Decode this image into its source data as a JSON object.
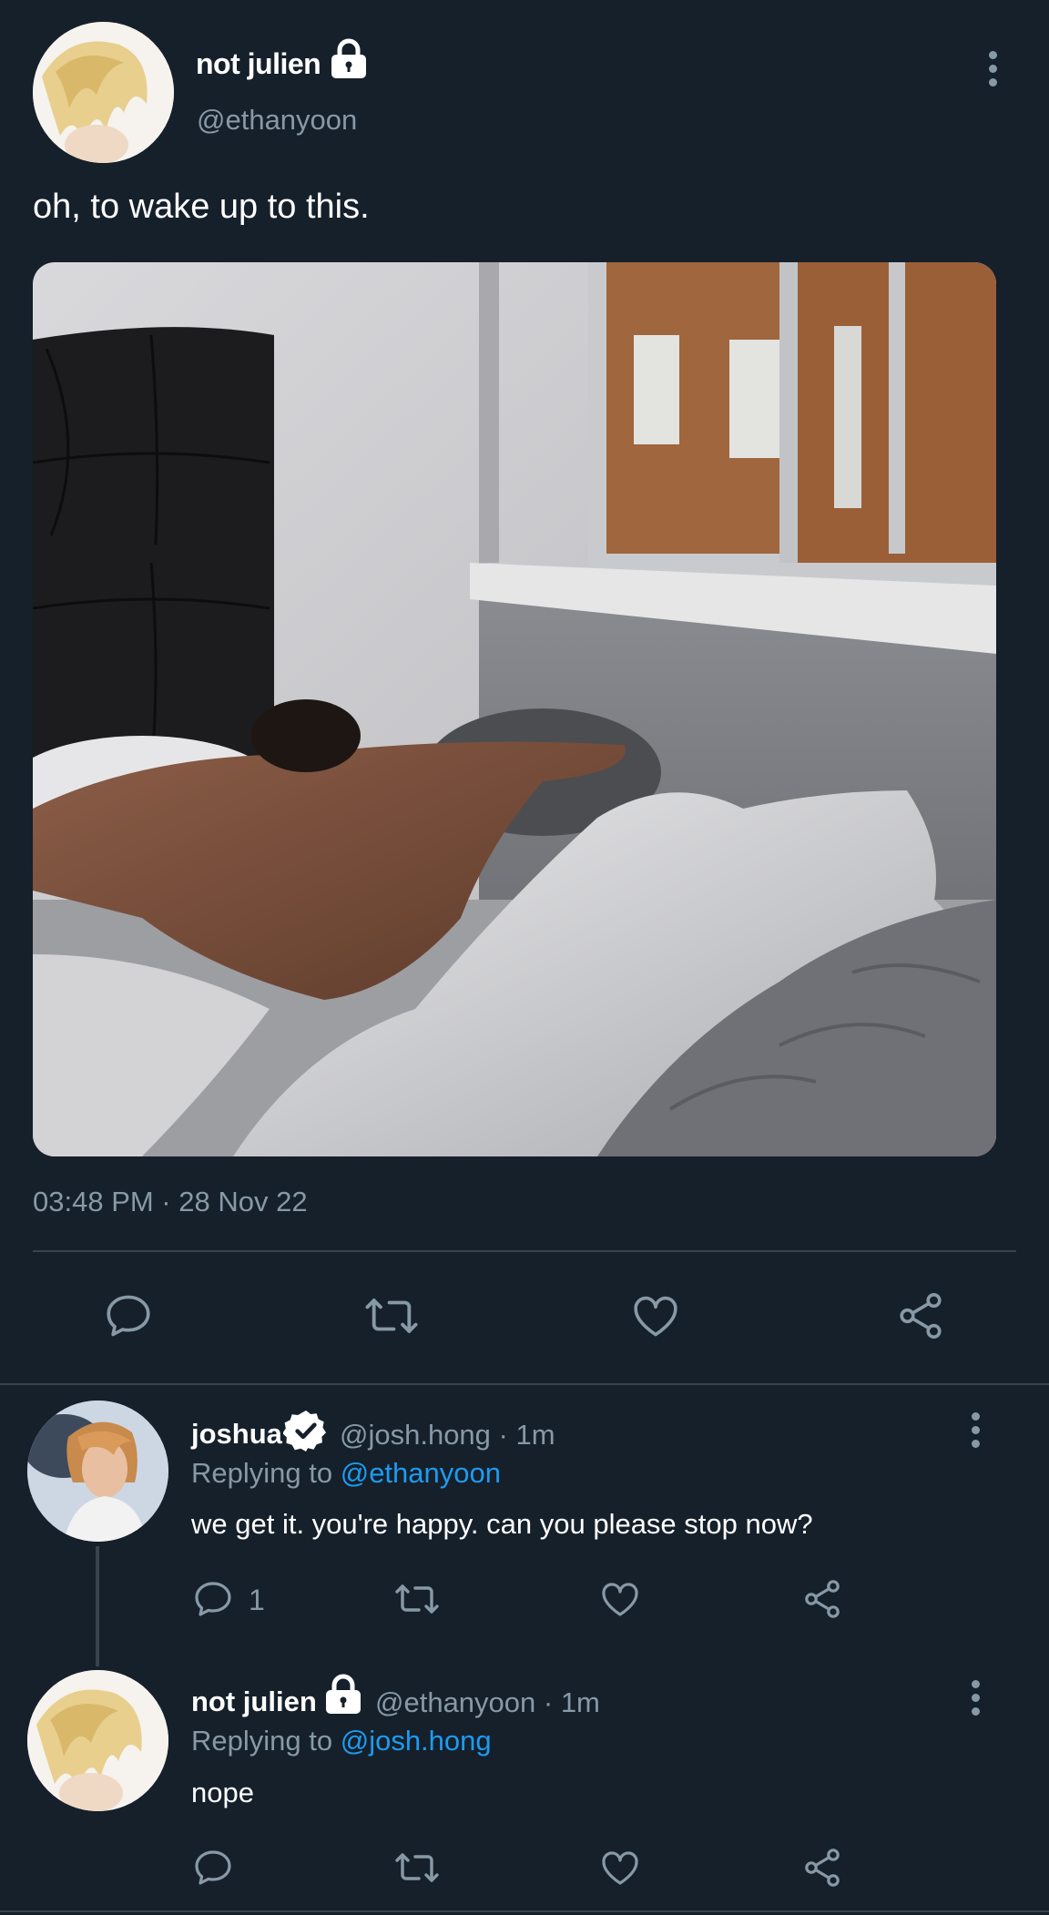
{
  "main_tweet": {
    "display_name": "not julien",
    "handle": "@ethanyoon",
    "text": "oh, to wake up to this.",
    "timestamp": "03:48 PM · 28 Nov 22"
  },
  "replies": [
    {
      "display_name": "joshua",
      "handle_time": "@josh.hong · 1m",
      "replying_prefix": "Replying to ",
      "replying_to": "@ethanyoon",
      "text": "we get it. you're happy. can you please stop now?",
      "reply_count": "1",
      "verified": true
    },
    {
      "display_name": "not julien",
      "handle_time": "@ethanyoon · 1m",
      "replying_prefix": "Replying to ",
      "replying_to": "@josh.hong",
      "text": "nope",
      "reply_count": "",
      "locked": true
    }
  ],
  "icons": [
    "lock-icon",
    "more-options-icon",
    "reply-icon",
    "retweet-icon",
    "like-icon",
    "share-icon",
    "verified-badge-icon"
  ],
  "colors": {
    "background": "#15202b",
    "text_secondary": "#8899a6",
    "link": "#1d9bf0",
    "divider": "#38444d"
  }
}
